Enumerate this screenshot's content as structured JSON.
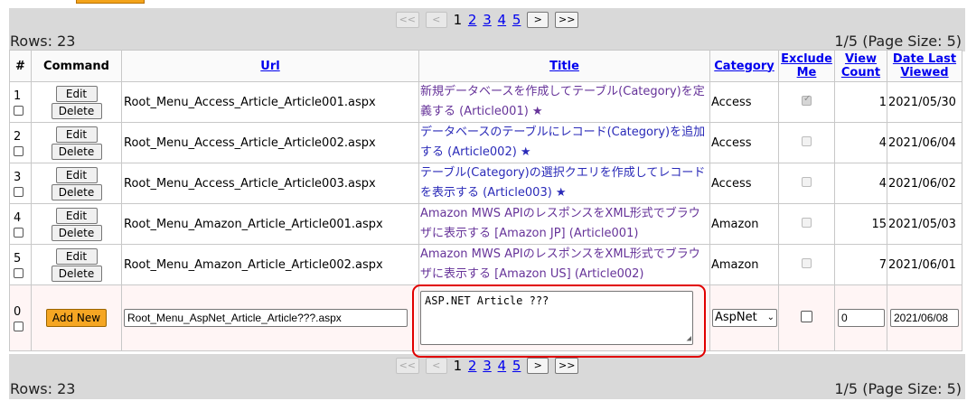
{
  "pager": {
    "first": "<<",
    "prev": "<",
    "next": ">",
    "last": ">>",
    "pages": [
      "1",
      "2",
      "3",
      "4",
      "5"
    ],
    "current_page": "1"
  },
  "rows_label": "Rows: 23",
  "page_info": "1/5 (Page Size: 5)",
  "columns": {
    "num": "#",
    "command": "Command",
    "url": "Url",
    "title": "Title",
    "category": "Category",
    "exclude_me": "Exclude Me",
    "view_count": "View Count",
    "date_last_viewed": "Date Last Viewed"
  },
  "buttons": {
    "edit": "Edit",
    "delete": "Delete",
    "add_new": "Add New"
  },
  "rows": [
    {
      "num": "1",
      "url": "Root_Menu_Access_Article_Article001.aspx",
      "title": "新規データベースを作成してテーブル(Category)を定義する (Article001) ★",
      "category": "Access",
      "exclude_me": true,
      "view_count": "1",
      "date_last_viewed": "2021/05/30"
    },
    {
      "num": "2",
      "url": "Root_Menu_Access_Article_Article002.aspx",
      "title": "データベースのテーブルにレコード(Category)を追加する (Article002) ★",
      "category": "Access",
      "exclude_me": false,
      "view_count": "4",
      "date_last_viewed": "2021/06/04"
    },
    {
      "num": "3",
      "url": "Root_Menu_Access_Article_Article003.aspx",
      "title": "テーブル(Category)の選択クエリを作成してレコードを表示する (Article003) ★",
      "category": "Access",
      "exclude_me": false,
      "view_count": "4",
      "date_last_viewed": "2021/06/02"
    },
    {
      "num": "4",
      "url": "Root_Menu_Amazon_Article_Article001.aspx",
      "title": "Amazon MWS APIのレスポンスをXML形式でブラウザに表示する [Amazon JP] (Article001)",
      "category": "Amazon",
      "exclude_me": false,
      "view_count": "15",
      "date_last_viewed": "2021/05/03"
    },
    {
      "num": "5",
      "url": "Root_Menu_Amazon_Article_Article002.aspx",
      "title": "Amazon MWS APIのレスポンスをXML形式でブラウザに表示する [Amazon US] (Article002)",
      "category": "Amazon",
      "exclude_me": false,
      "view_count": "7",
      "date_last_viewed": "2021/06/01"
    }
  ],
  "new_row": {
    "num": "0",
    "url_value": "Root_Menu_AspNet_Article_Article???.aspx",
    "title_value": "ASP.NET Article ???",
    "category_value": "AspNet",
    "view_count_value": "0",
    "date_value": "2021/06/08"
  },
  "colors": {
    "add_new_button": "#f5a623",
    "pager_band": "#d9d9d9",
    "highlight": "#e10000",
    "link": "#0000ee",
    "visited_link": "#663399"
  }
}
